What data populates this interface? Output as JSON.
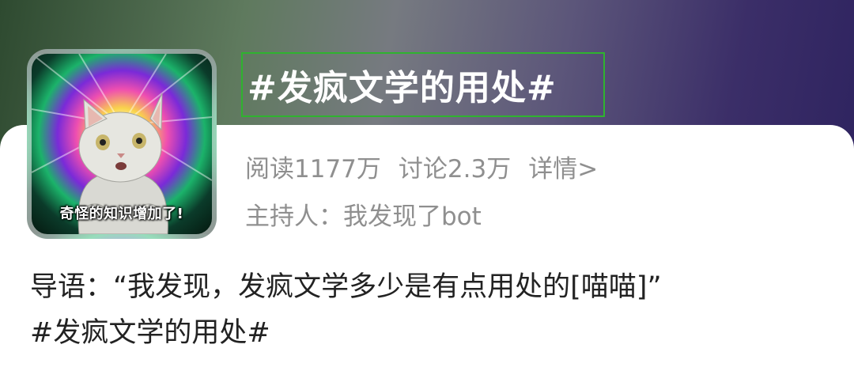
{
  "topic": {
    "title": "#发疯文学的用处#",
    "thumbnail_caption": "奇怪的知识增加了!",
    "stats": {
      "reads": "阅读1177万",
      "discussions": "讨论2.3万",
      "details_link": "详情>"
    },
    "host": "主持人：我发现了bot"
  },
  "intro": {
    "line1": "导语：“我发现，发疯文学多少是有点用处的[喵喵]”",
    "line2": "#发疯文学的用处#"
  }
}
